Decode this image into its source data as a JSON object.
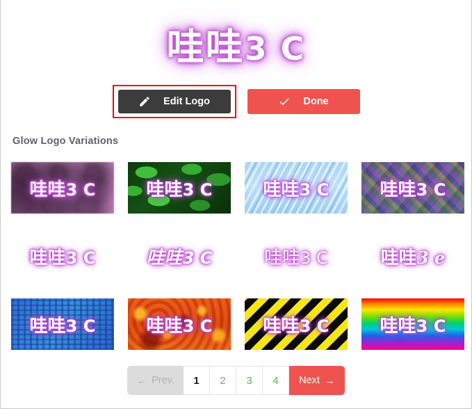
{
  "hero": {
    "logo_cjk": "哇哇",
    "logo_latin": "3 C"
  },
  "actions": {
    "edit_label": "Edit Logo",
    "edit_icon": "pencil-icon",
    "edit_bg": "#3c3c3c",
    "done_label": "Done",
    "done_icon": "check-icon",
    "done_bg": "#ef5350",
    "highlight_color": "#ff0000"
  },
  "section": {
    "title": "Glow Logo Variations"
  },
  "thumbnails": [
    {
      "text_cjk": "哇哇",
      "text_latin": "3 C",
      "style": "pink-blur-background"
    },
    {
      "text_cjk": "哇哇",
      "text_latin": "3 C",
      "style": "green-leaves-background"
    },
    {
      "text_cjk": "哇哇",
      "text_latin": "3 C",
      "style": "blue-streaks-background"
    },
    {
      "text_cjk": "哇哇",
      "text_latin": "3 C",
      "style": "purple-fractal-background"
    },
    {
      "text_cjk": "哇哇",
      "text_latin": "3 C",
      "style": "transparent-bold"
    },
    {
      "text_cjk": "哇哇",
      "text_latin": "3 C",
      "style": "transparent-script"
    },
    {
      "text_cjk": "哇哇",
      "text_latin": "3 C",
      "style": "transparent-thin"
    },
    {
      "text_cjk": "哇哇",
      "text_latin": "3 e",
      "style": "transparent-cursive"
    },
    {
      "text_cjk": "哇哇",
      "text_latin": "3 C",
      "style": "blue-plaid-background"
    },
    {
      "text_cjk": "哇哇",
      "text_latin": "3 C",
      "style": "red-fire-background"
    },
    {
      "text_cjk": "哇哇",
      "text_latin": "3 C",
      "style": "yellow-hazard-background"
    },
    {
      "text_cjk": "哇哇",
      "text_latin": "3 C",
      "style": "rainbow-gradient-background"
    }
  ],
  "pagination": {
    "prev_label": "Prev.",
    "prev_arrow": "←",
    "next_label": "Next",
    "next_arrow": "→",
    "pages": [
      "1",
      "2",
      "3",
      "4"
    ],
    "active_page": "1",
    "link_color": "#5cb85c",
    "next_bg": "#ef5350"
  }
}
